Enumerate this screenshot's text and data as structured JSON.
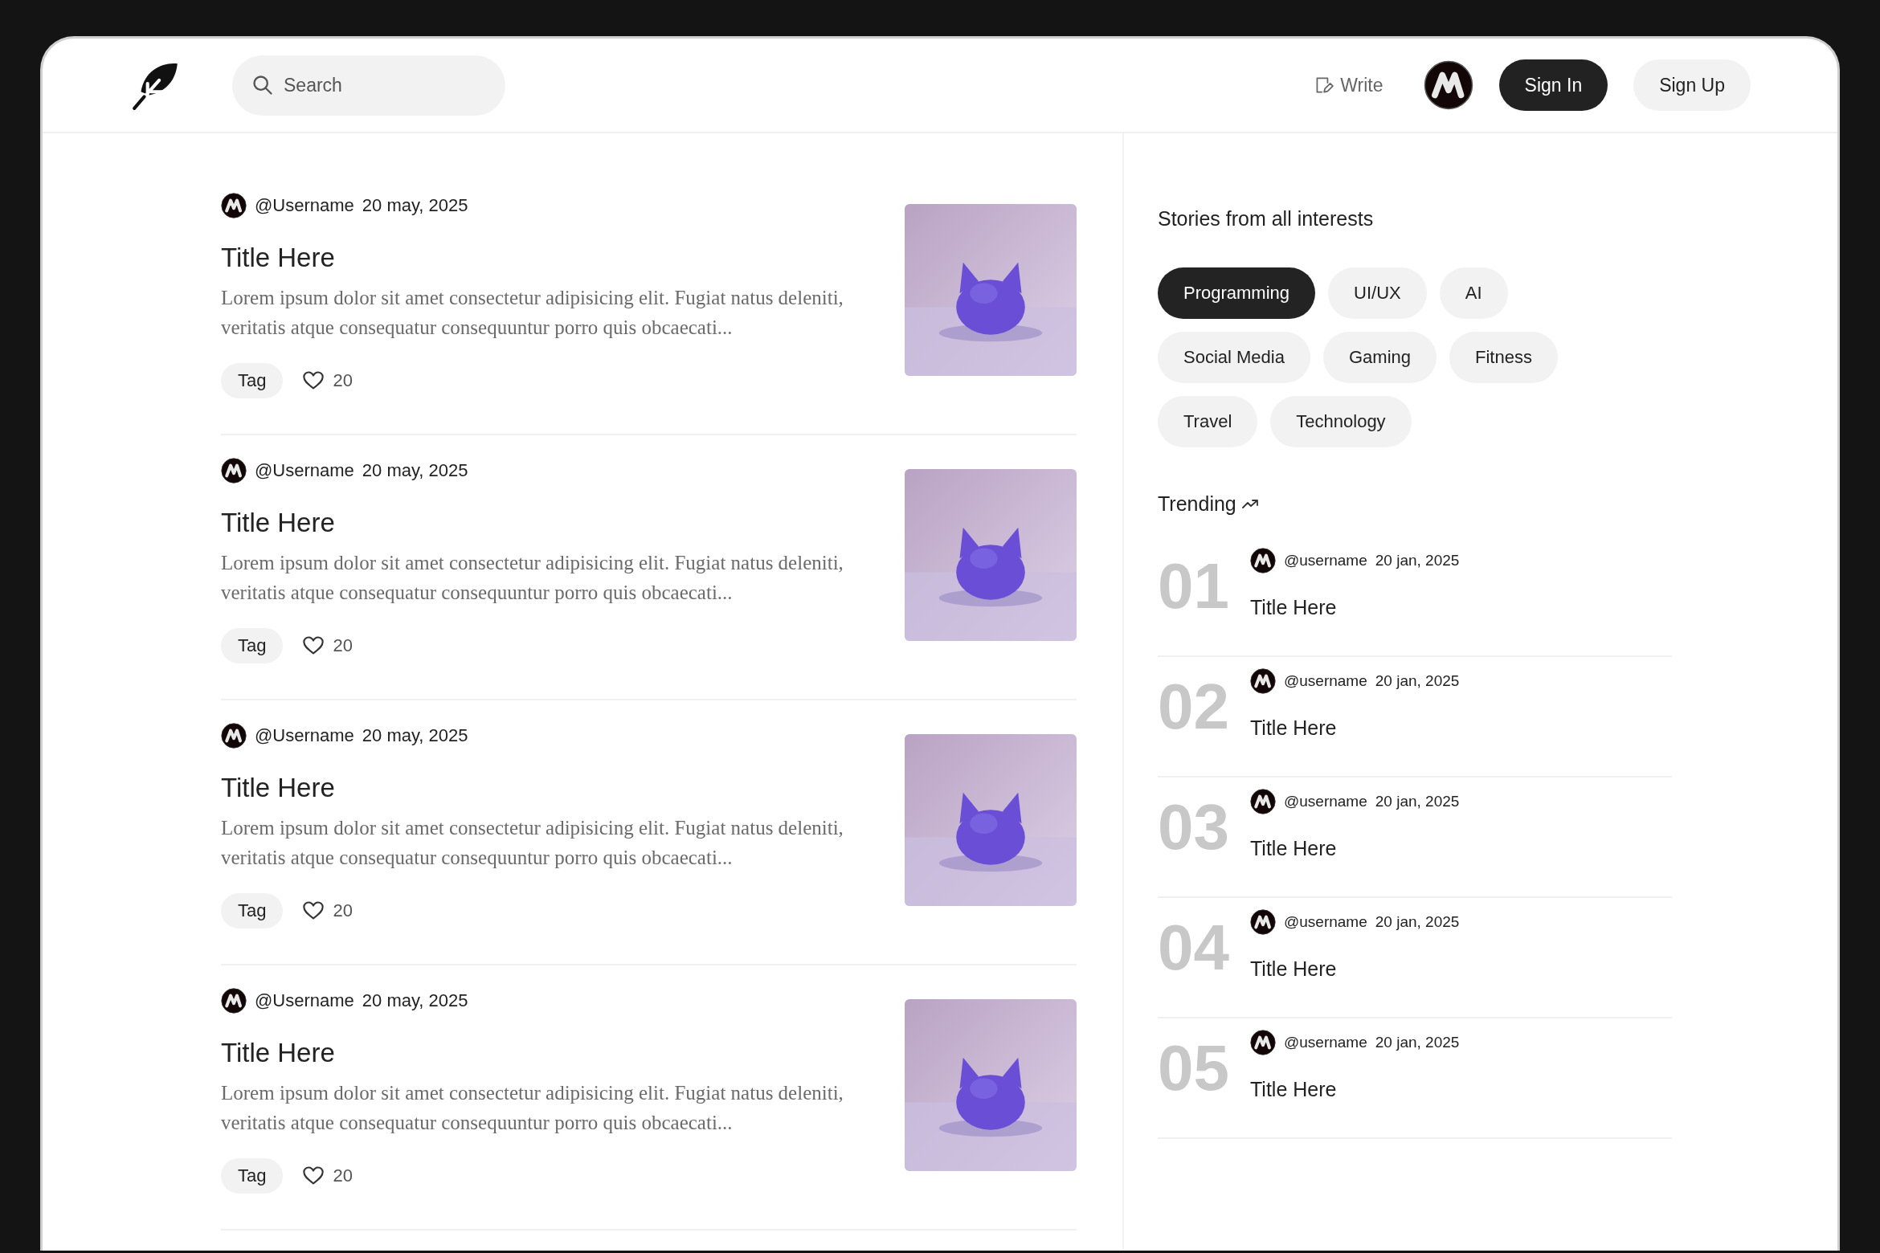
{
  "header": {
    "search": {
      "placeholder": "Search"
    },
    "write": "Write",
    "buttons": [
      {
        "label": "Sign In",
        "kind": "primary"
      },
      {
        "label": "Sign Up",
        "kind": "secondary"
      }
    ]
  },
  "posts": [
    {
      "author": "@Username",
      "date": "20 may, 2025",
      "title": "Title Here",
      "excerpt": "Lorem ipsum dolor sit amet consectetur adipisicing elit. Fugiat natus deleniti, veritatis atque consequatur consequuntur porro quis obcaecati...",
      "tag": "Tag",
      "likes": "20"
    },
    {
      "author": "@Username",
      "date": "20 may, 2025",
      "title": "Title Here",
      "excerpt": "Lorem ipsum dolor sit amet consectetur adipisicing elit. Fugiat natus deleniti, veritatis atque consequatur consequuntur porro quis obcaecati...",
      "tag": "Tag",
      "likes": "20"
    },
    {
      "author": "@Username",
      "date": "20 may, 2025",
      "title": "Title Here",
      "excerpt": "Lorem ipsum dolor sit amet consectetur adipisicing elit. Fugiat natus deleniti, veritatis atque consequatur consequuntur porro quis obcaecati...",
      "tag": "Tag",
      "likes": "20"
    },
    {
      "author": "@Username",
      "date": "20 may, 2025",
      "title": "Title Here",
      "excerpt": "Lorem ipsum dolor sit amet consectetur adipisicing elit. Fugiat natus deleniti, veritatis atque consequatur consequuntur porro quis obcaecati...",
      "tag": "Tag",
      "likes": "20"
    }
  ],
  "sidebar": {
    "interests_title": "Stories from all interests",
    "topics": [
      {
        "label": "Programming",
        "selected": true
      },
      {
        "label": "UI/UX",
        "selected": false
      },
      {
        "label": "AI",
        "selected": false
      },
      {
        "label": "Social Media",
        "selected": false
      },
      {
        "label": "Gaming",
        "selected": false
      },
      {
        "label": "Fitness",
        "selected": false
      },
      {
        "label": "Travel",
        "selected": false
      },
      {
        "label": "Technology",
        "selected": false
      }
    ],
    "trending_title": "Trending",
    "trending": [
      {
        "rank": "01",
        "author": "@username",
        "date": "20 jan, 2025",
        "title": "Title Here"
      },
      {
        "rank": "02",
        "author": "@username",
        "date": "20 jan, 2025",
        "title": "Title Here"
      },
      {
        "rank": "03",
        "author": "@username",
        "date": "20 jan, 2025",
        "title": "Title Here"
      },
      {
        "rank": "04",
        "author": "@username",
        "date": "20 jan, 2025",
        "title": "Title Here"
      },
      {
        "rank": "05",
        "author": "@username",
        "date": "20 jan, 2025",
        "title": "Title Here"
      }
    ]
  }
}
